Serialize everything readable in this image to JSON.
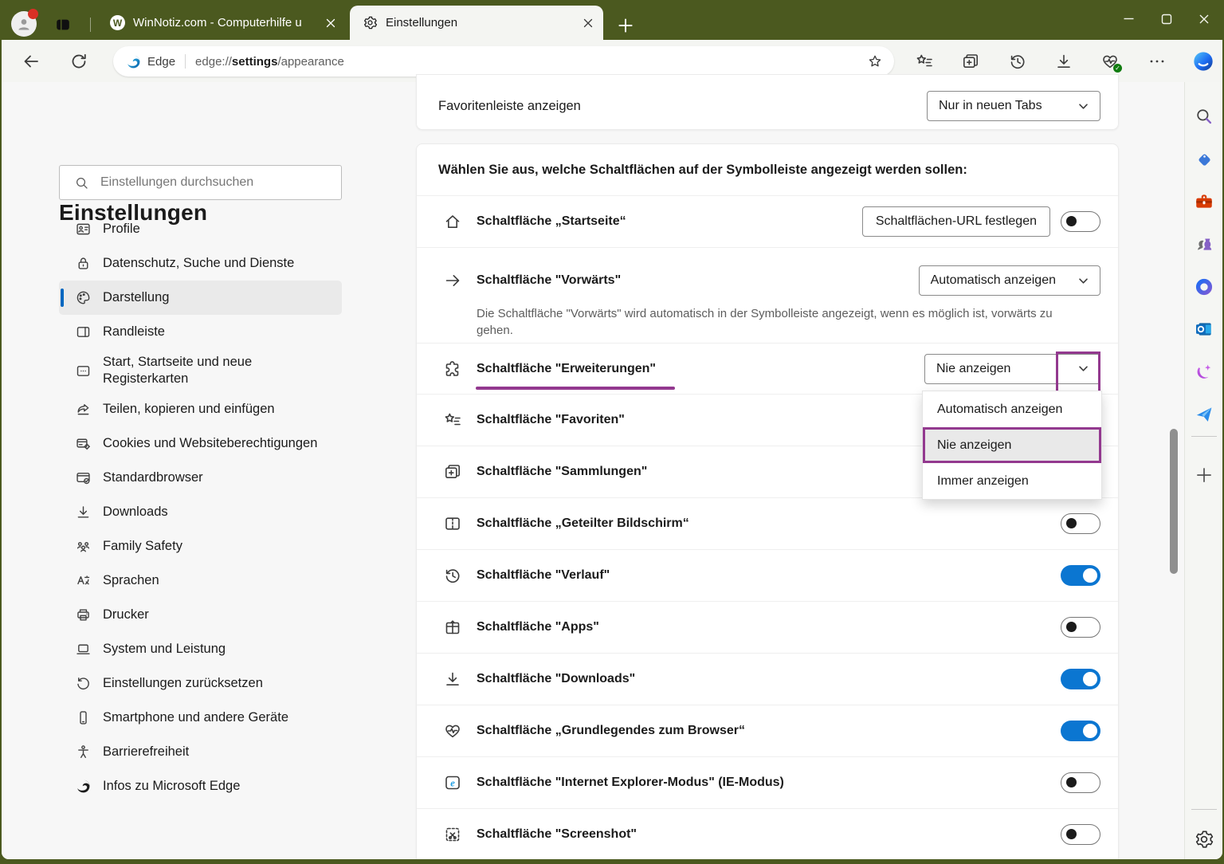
{
  "colors": {
    "titlebar_green": "#4B591F",
    "annotation_purple": "#93398F",
    "toggle_on_blue": "#0B76D1",
    "sidebar_accent_blue": "#0067C0"
  },
  "tabs": [
    {
      "title": "WinNotiz.com - Computerhilfe u",
      "favicon": "wordpress-icon",
      "active": false
    },
    {
      "title": "Einstellungen",
      "favicon": "gear-icon",
      "active": true
    }
  ],
  "toolbar": {
    "browser_label": "Edge",
    "url_prefix": "edge://",
    "url_bold": "settings",
    "url_suffix": "/appearance",
    "icons": [
      "favorites-icon",
      "collections-icon",
      "history-icon",
      "downloads-icon",
      "browser-essentials-icon",
      "more-icon"
    ]
  },
  "sidebar": {
    "title": "Einstellungen",
    "search_placeholder": "Einstellungen durchsuchen",
    "items": [
      {
        "icon": "profile-icon",
        "label": "Profile",
        "selected": false
      },
      {
        "icon": "privacy-icon",
        "label": "Datenschutz, Suche und Dienste",
        "selected": false
      },
      {
        "icon": "appearance-icon",
        "label": "Darstellung",
        "selected": true
      },
      {
        "icon": "sidebar-icon",
        "label": "Randleiste",
        "selected": false
      },
      {
        "icon": "startpage-icon",
        "label": "Start, Startseite und neue Registerkarten",
        "selected": false
      },
      {
        "icon": "share-icon",
        "label": "Teilen, kopieren und einfügen",
        "selected": false
      },
      {
        "icon": "cookies-icon",
        "label": "Cookies und Websiteberechtigungen",
        "selected": false
      },
      {
        "icon": "default-browser-icon",
        "label": "Standardbrowser",
        "selected": false
      },
      {
        "icon": "downloads-icon",
        "label": "Downloads",
        "selected": false
      },
      {
        "icon": "family-icon",
        "label": "Family Safety",
        "selected": false
      },
      {
        "icon": "languages-icon",
        "label": "Sprachen",
        "selected": false
      },
      {
        "icon": "printer-icon",
        "label": "Drucker",
        "selected": false
      },
      {
        "icon": "system-icon",
        "label": "System und Leistung",
        "selected": false
      },
      {
        "icon": "reset-icon",
        "label": "Einstellungen zurücksetzen",
        "selected": false
      },
      {
        "icon": "phone-icon",
        "label": "Smartphone und andere Geräte",
        "selected": false
      },
      {
        "icon": "accessibility-icon",
        "label": "Barrierefreiheit",
        "selected": false
      },
      {
        "icon": "edge-logo-icon",
        "label": "Infos zu Microsoft Edge",
        "selected": false
      }
    ]
  },
  "content": {
    "favorites_bar_row": {
      "label": "Favoritenleiste anzeigen",
      "value": "Nur in neuen Tabs"
    },
    "section_heading": "Wählen Sie aus, welche Schaltflächen auf der Symbolleiste angezeigt werden sollen:",
    "rows": [
      {
        "icon": "home-icon",
        "label": "Schaltfläche „Startseite“",
        "control": "button-toggle",
        "button_label": "Schaltflächen-URL festlegen",
        "toggle": false
      },
      {
        "icon": "forward-arrow-icon",
        "label": "Schaltfläche \"Vorwärts\"",
        "control": "dropdown",
        "value": "Automatisch anzeigen",
        "description": "Die Schaltfläche \"Vorwärts\" wird automatisch in der Symbolleiste angezeigt, wenn es möglich ist, vorwärts zu gehen."
      },
      {
        "icon": "extensions-icon",
        "label": "Schaltfläche \"Erweiterungen\"",
        "control": "select-annotated",
        "value": "Nie anzeigen"
      },
      {
        "icon": "favorites-icon",
        "label": "Schaltfläche \"Favoriten\"",
        "control": "hidden"
      },
      {
        "icon": "collections-icon",
        "label": "Schaltfläche \"Sammlungen\"",
        "control": "hidden"
      },
      {
        "icon": "split-screen-icon",
        "label": "Schaltfläche „Geteilter Bildschirm“",
        "control": "toggle",
        "toggle": false
      },
      {
        "icon": "history-icon",
        "label": "Schaltfläche \"Verlauf\"",
        "control": "toggle",
        "toggle": true
      },
      {
        "icon": "apps-icon",
        "label": "Schaltfläche \"Apps\"",
        "control": "toggle",
        "toggle": false
      },
      {
        "icon": "downloads-icon",
        "label": "Schaltfläche \"Downloads\"",
        "control": "toggle",
        "toggle": true
      },
      {
        "icon": "browser-essentials-icon",
        "label": "Schaltfläche „Grundlegendes zum Browser“",
        "control": "toggle",
        "toggle": true
      },
      {
        "icon": "ie-mode-icon",
        "label": "Schaltfläche \"Internet Explorer-Modus\" (IE-Modus)",
        "control": "toggle",
        "toggle": false
      },
      {
        "icon": "screenshot-icon",
        "label": "Schaltfläche \"Screenshot\"",
        "control": "toggle",
        "toggle": false
      }
    ],
    "dropdown_menu": {
      "options": [
        "Automatisch anzeigen",
        "Nie anzeigen",
        "Immer anzeigen"
      ],
      "selected_index": 1
    }
  },
  "rail": {
    "icons": [
      "search-icon",
      "shopping-icon",
      "toolbox-icon",
      "games-icon",
      "m365-icon",
      "outlook-icon",
      "image-creator-icon",
      "drop-icon"
    ]
  }
}
